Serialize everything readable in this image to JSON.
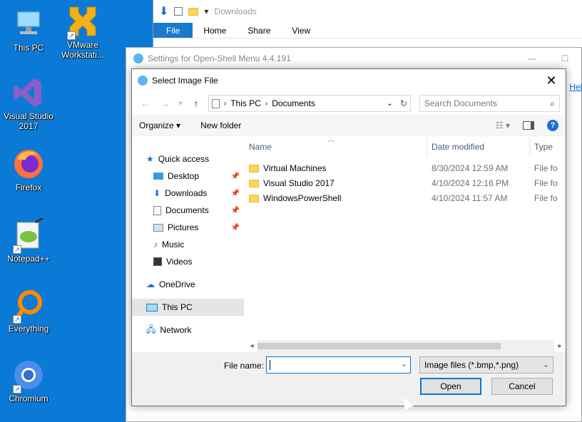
{
  "desktop": {
    "icons": [
      {
        "label": "This PC"
      },
      {
        "label": "VMware Workstati..."
      },
      {
        "label": "Visual Studio 2017"
      },
      {
        "label": "Firefox"
      },
      {
        "label": "Notepad++"
      },
      {
        "label": "Everything"
      },
      {
        "label": "Chromium"
      }
    ]
  },
  "explorer": {
    "path_label": "Downloads",
    "tabs": [
      "File",
      "Home",
      "Share",
      "View"
    ]
  },
  "settings": {
    "title": "Settings for Open-Shell Menu 4.4.191",
    "help_partial": "Help"
  },
  "dialog": {
    "title": "Select Image File",
    "breadcrumb": [
      "This PC",
      "Documents"
    ],
    "search_placeholder": "Search Documents",
    "organize_label": "Organize",
    "new_folder_label": "New folder",
    "nav": {
      "quick_access": "Quick access",
      "desktop": "Desktop",
      "downloads": "Downloads",
      "documents": "Documents",
      "pictures": "Pictures",
      "music": "Music",
      "videos": "Videos",
      "onedrive": "OneDrive",
      "this_pc": "This PC",
      "network": "Network"
    },
    "columns": {
      "name": "Name",
      "date": "Date modified",
      "type": "Type"
    },
    "files": [
      {
        "name": "Virtual Machines",
        "date": "8/30/2024 12:59 AM",
        "type": "File fo"
      },
      {
        "name": "Visual Studio 2017",
        "date": "4/10/2024 12:16 PM",
        "type": "File fo"
      },
      {
        "name": "WindowsPowerShell",
        "date": "4/10/2024 11:57 AM",
        "type": "File fo"
      }
    ],
    "file_name_label": "File name:",
    "file_name_value": "",
    "filter_value": "Image files (*.bmp,*.png)",
    "open_label": "Open",
    "cancel_label": "Cancel"
  },
  "colors": {
    "desktop_bg": "#0a7ad6",
    "accent": "#0078d7",
    "folder": "#ffd457"
  }
}
